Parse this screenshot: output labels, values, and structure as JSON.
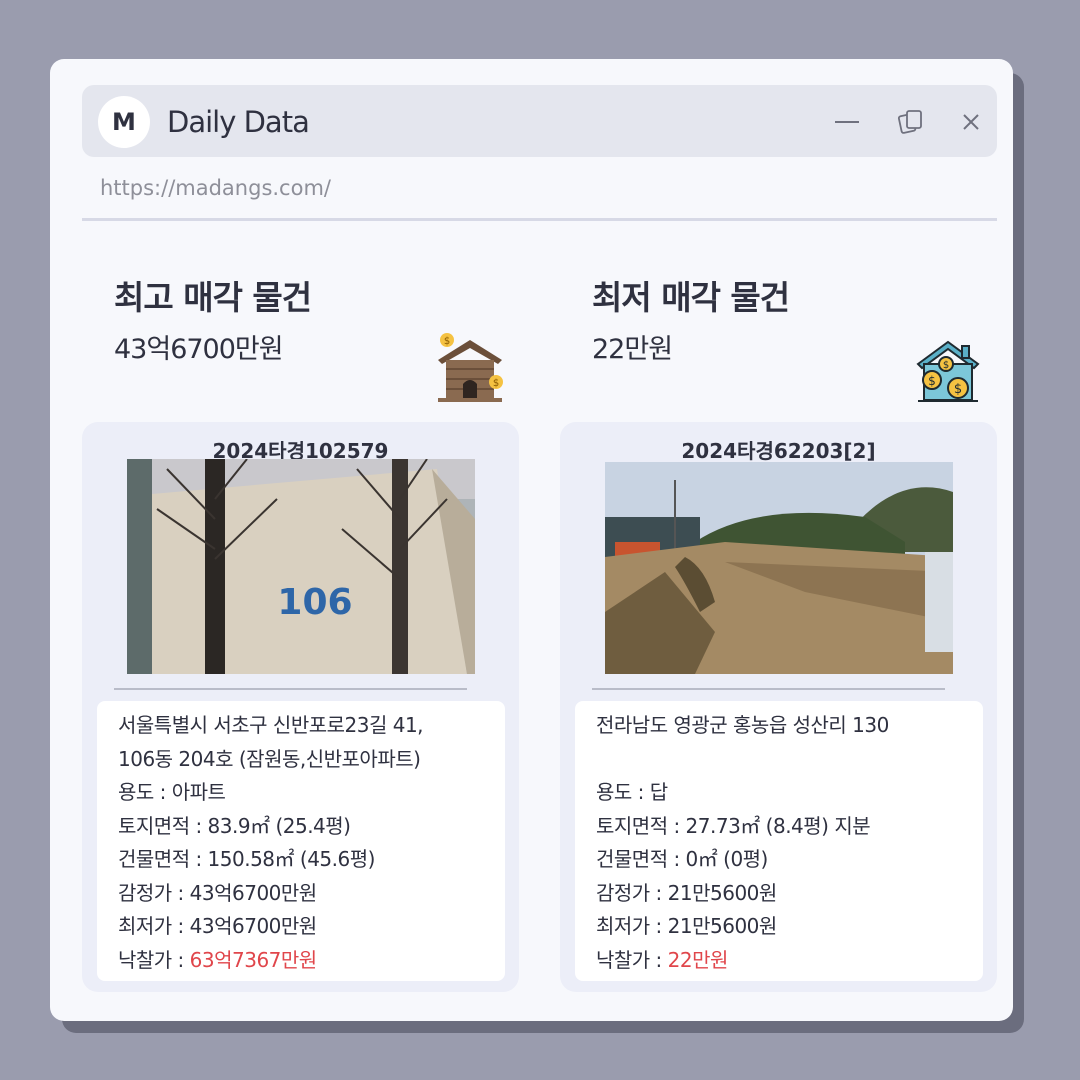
{
  "window": {
    "logo_letter": "M",
    "title": "Daily Data",
    "url": "https://madangs.com/"
  },
  "highest": {
    "heading": "최고 매각 물건",
    "amount": "43억6700만원",
    "case_no": "2024타경102579",
    "address_line1": "서울특별시 서초구 신반포로23길 41,",
    "address_line2": "106동 204호 (잠원동,신반포아파트)",
    "usage": "용도 : 아파트",
    "land_area": "토지면적 : 83.9㎡ (25.4평)",
    "building_area": "건물면적 : 150.58㎡ (45.6평)",
    "appraisal": "감정가 : 43억6700만원",
    "minimum": "최저가 : 43억6700만원",
    "winning_label": "낙찰가 : ",
    "winning_value": "63억7367만원",
    "photo_number": "106"
  },
  "lowest": {
    "heading": "최저 매각 물건",
    "amount": "22만원",
    "case_no": "2024타경62203[2]",
    "address_line1": "전라남도 영광군 홍농읍 성산리 130",
    "address_line2": "",
    "usage": "용도 : 답",
    "land_area": "토지면적 : 27.73㎡ (8.4평) 지분",
    "building_area": "건물면적 : 0㎡ (0평)",
    "appraisal": "감정가 : 21만5600원",
    "minimum": "최저가 : 21만5600원",
    "winning_label": "낙찰가 : ",
    "winning_value": "22만원"
  },
  "icons": {
    "minimize": "minimize-icon",
    "restore": "restore-icon",
    "close": "close-icon",
    "house_left": "house-money-icon",
    "house_right": "house-coins-icon"
  },
  "colors": {
    "accent_red": "#e0464b",
    "background": "#9a9cae"
  }
}
